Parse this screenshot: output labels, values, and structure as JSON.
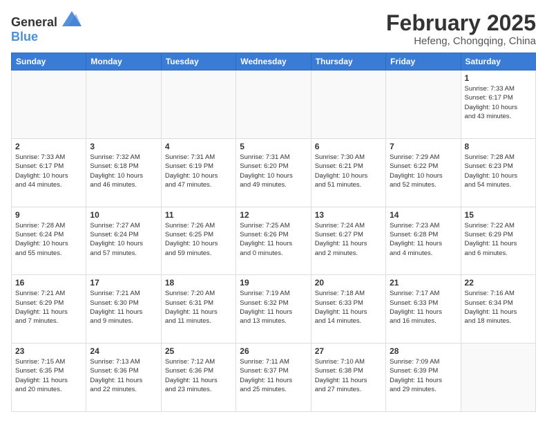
{
  "logo": {
    "general": "General",
    "blue": "Blue"
  },
  "header": {
    "month": "February 2025",
    "location": "Hefeng, Chongqing, China"
  },
  "weekdays": [
    "Sunday",
    "Monday",
    "Tuesday",
    "Wednesday",
    "Thursday",
    "Friday",
    "Saturday"
  ],
  "weeks": [
    [
      {
        "day": "",
        "info": ""
      },
      {
        "day": "",
        "info": ""
      },
      {
        "day": "",
        "info": ""
      },
      {
        "day": "",
        "info": ""
      },
      {
        "day": "",
        "info": ""
      },
      {
        "day": "",
        "info": ""
      },
      {
        "day": "1",
        "info": "Sunrise: 7:33 AM\nSunset: 6:17 PM\nDaylight: 10 hours\nand 43 minutes."
      }
    ],
    [
      {
        "day": "2",
        "info": "Sunrise: 7:33 AM\nSunset: 6:17 PM\nDaylight: 10 hours\nand 44 minutes."
      },
      {
        "day": "3",
        "info": "Sunrise: 7:32 AM\nSunset: 6:18 PM\nDaylight: 10 hours\nand 46 minutes."
      },
      {
        "day": "4",
        "info": "Sunrise: 7:31 AM\nSunset: 6:19 PM\nDaylight: 10 hours\nand 47 minutes."
      },
      {
        "day": "5",
        "info": "Sunrise: 7:31 AM\nSunset: 6:20 PM\nDaylight: 10 hours\nand 49 minutes."
      },
      {
        "day": "6",
        "info": "Sunrise: 7:30 AM\nSunset: 6:21 PM\nDaylight: 10 hours\nand 51 minutes."
      },
      {
        "day": "7",
        "info": "Sunrise: 7:29 AM\nSunset: 6:22 PM\nDaylight: 10 hours\nand 52 minutes."
      },
      {
        "day": "8",
        "info": "Sunrise: 7:28 AM\nSunset: 6:23 PM\nDaylight: 10 hours\nand 54 minutes."
      }
    ],
    [
      {
        "day": "9",
        "info": "Sunrise: 7:28 AM\nSunset: 6:24 PM\nDaylight: 10 hours\nand 55 minutes."
      },
      {
        "day": "10",
        "info": "Sunrise: 7:27 AM\nSunset: 6:24 PM\nDaylight: 10 hours\nand 57 minutes."
      },
      {
        "day": "11",
        "info": "Sunrise: 7:26 AM\nSunset: 6:25 PM\nDaylight: 10 hours\nand 59 minutes."
      },
      {
        "day": "12",
        "info": "Sunrise: 7:25 AM\nSunset: 6:26 PM\nDaylight: 11 hours\nand 0 minutes."
      },
      {
        "day": "13",
        "info": "Sunrise: 7:24 AM\nSunset: 6:27 PM\nDaylight: 11 hours\nand 2 minutes."
      },
      {
        "day": "14",
        "info": "Sunrise: 7:23 AM\nSunset: 6:28 PM\nDaylight: 11 hours\nand 4 minutes."
      },
      {
        "day": "15",
        "info": "Sunrise: 7:22 AM\nSunset: 6:29 PM\nDaylight: 11 hours\nand 6 minutes."
      }
    ],
    [
      {
        "day": "16",
        "info": "Sunrise: 7:21 AM\nSunset: 6:29 PM\nDaylight: 11 hours\nand 7 minutes."
      },
      {
        "day": "17",
        "info": "Sunrise: 7:21 AM\nSunset: 6:30 PM\nDaylight: 11 hours\nand 9 minutes."
      },
      {
        "day": "18",
        "info": "Sunrise: 7:20 AM\nSunset: 6:31 PM\nDaylight: 11 hours\nand 11 minutes."
      },
      {
        "day": "19",
        "info": "Sunrise: 7:19 AM\nSunset: 6:32 PM\nDaylight: 11 hours\nand 13 minutes."
      },
      {
        "day": "20",
        "info": "Sunrise: 7:18 AM\nSunset: 6:33 PM\nDaylight: 11 hours\nand 14 minutes."
      },
      {
        "day": "21",
        "info": "Sunrise: 7:17 AM\nSunset: 6:33 PM\nDaylight: 11 hours\nand 16 minutes."
      },
      {
        "day": "22",
        "info": "Sunrise: 7:16 AM\nSunset: 6:34 PM\nDaylight: 11 hours\nand 18 minutes."
      }
    ],
    [
      {
        "day": "23",
        "info": "Sunrise: 7:15 AM\nSunset: 6:35 PM\nDaylight: 11 hours\nand 20 minutes."
      },
      {
        "day": "24",
        "info": "Sunrise: 7:13 AM\nSunset: 6:36 PM\nDaylight: 11 hours\nand 22 minutes."
      },
      {
        "day": "25",
        "info": "Sunrise: 7:12 AM\nSunset: 6:36 PM\nDaylight: 11 hours\nand 23 minutes."
      },
      {
        "day": "26",
        "info": "Sunrise: 7:11 AM\nSunset: 6:37 PM\nDaylight: 11 hours\nand 25 minutes."
      },
      {
        "day": "27",
        "info": "Sunrise: 7:10 AM\nSunset: 6:38 PM\nDaylight: 11 hours\nand 27 minutes."
      },
      {
        "day": "28",
        "info": "Sunrise: 7:09 AM\nSunset: 6:39 PM\nDaylight: 11 hours\nand 29 minutes."
      },
      {
        "day": "",
        "info": ""
      }
    ]
  ]
}
